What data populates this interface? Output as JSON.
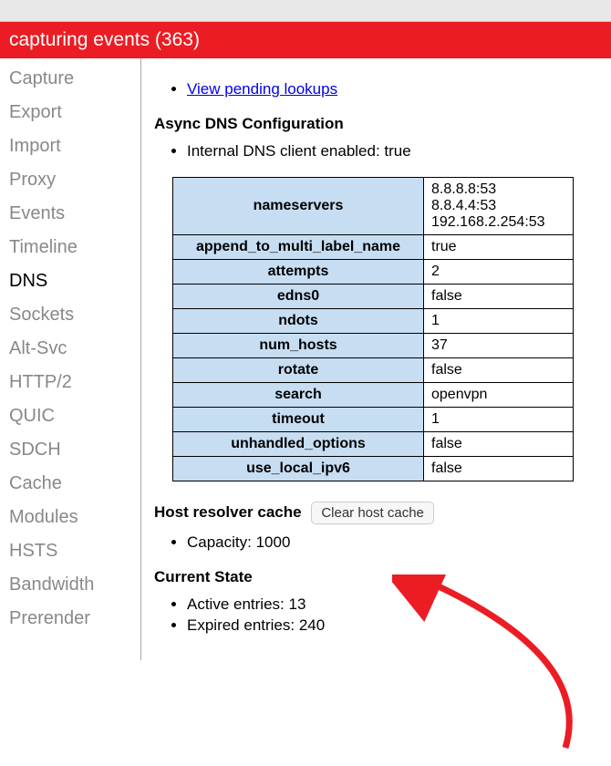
{
  "top": {},
  "banner": {
    "text": "capturing events (363)"
  },
  "sidebar": {
    "items": [
      {
        "label": "Capture",
        "active": false
      },
      {
        "label": "Export",
        "active": false
      },
      {
        "label": "Import",
        "active": false
      },
      {
        "label": "Proxy",
        "active": false
      },
      {
        "label": "Events",
        "active": false
      },
      {
        "label": "Timeline",
        "active": false
      },
      {
        "label": "DNS",
        "active": true
      },
      {
        "label": "Sockets",
        "active": false
      },
      {
        "label": "Alt-Svc",
        "active": false
      },
      {
        "label": "HTTP/2",
        "active": false
      },
      {
        "label": "QUIC",
        "active": false
      },
      {
        "label": "SDCH",
        "active": false
      },
      {
        "label": "Cache",
        "active": false
      },
      {
        "label": "Modules",
        "active": false
      },
      {
        "label": "HSTS",
        "active": false
      },
      {
        "label": "Bandwidth",
        "active": false
      },
      {
        "label": "Prerender",
        "active": false
      }
    ]
  },
  "main": {
    "pending_link": "View pending lookups",
    "async_heading": "Async DNS Configuration",
    "internal_client": "Internal DNS client enabled: true",
    "config_rows": [
      {
        "key": "nameservers",
        "val": "8.8.8.8:53\n8.8.4.4:53\n192.168.2.254:53"
      },
      {
        "key": "append_to_multi_label_name",
        "val": "true"
      },
      {
        "key": "attempts",
        "val": "2"
      },
      {
        "key": "edns0",
        "val": "false"
      },
      {
        "key": "ndots",
        "val": "1"
      },
      {
        "key": "num_hosts",
        "val": "37"
      },
      {
        "key": "rotate",
        "val": "false"
      },
      {
        "key": "search",
        "val": "openvpn"
      },
      {
        "key": "timeout",
        "val": "1"
      },
      {
        "key": "unhandled_options",
        "val": "false"
      },
      {
        "key": "use_local_ipv6",
        "val": "false"
      }
    ],
    "hrc_label": "Host resolver cache",
    "clear_button": "Clear host cache",
    "capacity": "Capacity: 1000",
    "current_state_heading": "Current State",
    "current_state_items": [
      "Active entries: 13",
      "Expired entries: 240"
    ]
  }
}
